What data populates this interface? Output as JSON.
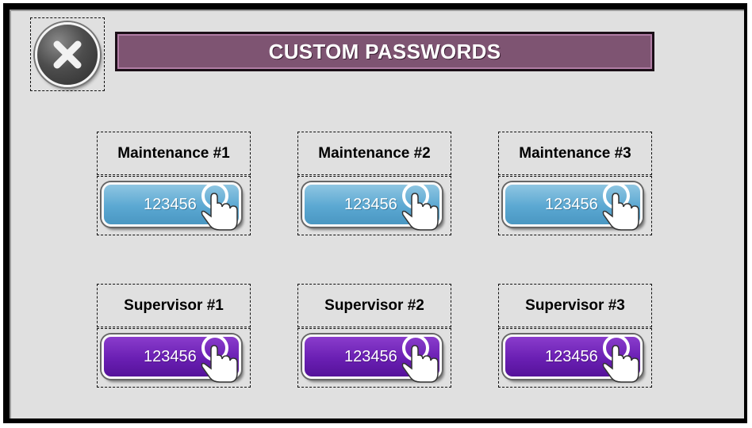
{
  "screen": {
    "title": "CUSTOM PASSWORDS",
    "close_icon": "close-x-icon"
  },
  "accounts": [
    {
      "label": "Maintenance #1",
      "password": "123456",
      "color": "#5ba8d2"
    },
    {
      "label": "Maintenance #2",
      "password": "123456",
      "color": "#5ba8d2"
    },
    {
      "label": "Maintenance #3",
      "password": "123456",
      "color": "#5ba8d2"
    },
    {
      "label": "Supervisor #1",
      "password": "123456",
      "color": "#6a1fb3"
    },
    {
      "label": "Supervisor #2",
      "password": "123456",
      "color": "#6a1fb3"
    },
    {
      "label": "Supervisor #3",
      "password": "123456",
      "color": "#6a1fb3"
    }
  ],
  "icons": {
    "press": "hand-pointer-icon"
  }
}
